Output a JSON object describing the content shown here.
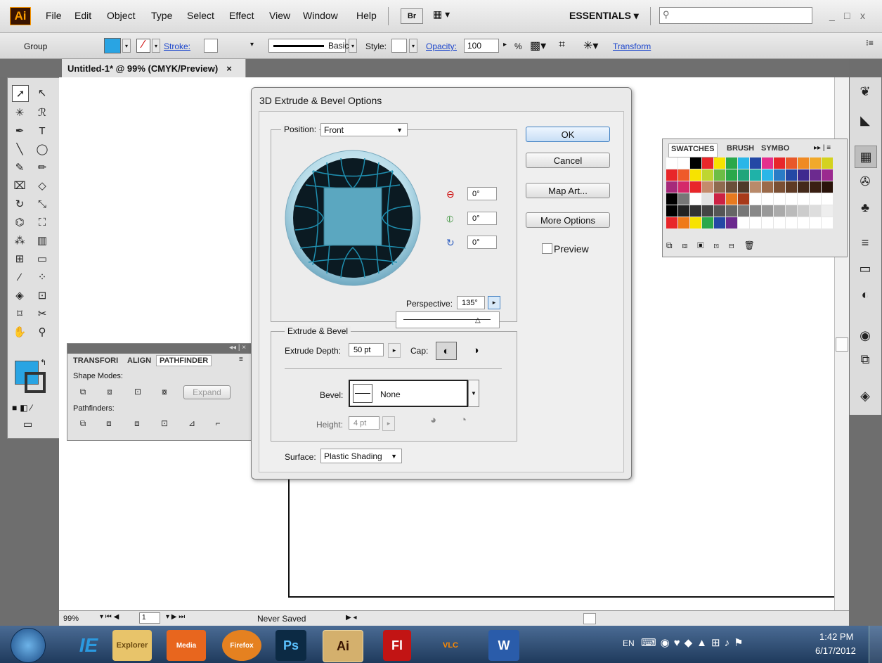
{
  "menu": {
    "logo": "Ai",
    "items": [
      "File",
      "Edit",
      "Object",
      "Type",
      "Select",
      "Effect",
      "View",
      "Window",
      "Help"
    ],
    "bridge": "Br",
    "workspace": "ESSENTIALS",
    "window_controls": [
      "_",
      "□",
      "x"
    ]
  },
  "control_bar": {
    "selection": "Group",
    "stroke_label": "Stroke:",
    "brush": "Basic",
    "style_label": "Style:",
    "opacity_label": "Opacity:",
    "opacity_value": "100",
    "percent": "%",
    "transform": "Transform"
  },
  "doc_tab": {
    "title": "Untitled-1* @ 99% (CMYK/Preview)",
    "close": "×"
  },
  "dialog": {
    "title": "3D Extrude & Bevel Options",
    "position_label": "Position:",
    "position_value": "Front",
    "rotation_x": "0°",
    "rotation_y": "0°",
    "rotation_z": "0°",
    "perspective_label": "Perspective:",
    "perspective_value": "135°",
    "buttons": {
      "ok": "OK",
      "cancel": "Cancel",
      "map_art": "Map Art...",
      "more_options": "More Options"
    },
    "preview_label": "Preview",
    "extrude_group": "Extrude & Bevel",
    "extrude_depth_label": "Extrude Depth:",
    "extrude_depth_value": "50 pt",
    "cap_label": "Cap:",
    "bevel_label": "Bevel:",
    "bevel_value": "None",
    "height_label": "Height:",
    "height_value": "4 pt",
    "surface_label": "Surface:",
    "surface_value": "Plastic Shading"
  },
  "swatches": {
    "tabs": [
      "SWATCHES",
      "BRUSH",
      "SYMBO"
    ]
  },
  "pathfinder": {
    "tabs": [
      "TRANSFORI",
      "ALIGN",
      "PATHFINDER"
    ],
    "shape_modes": "Shape Modes:",
    "expand": "Expand",
    "pathfinders": "Pathfinders:"
  },
  "status": {
    "zoom": "99%",
    "page": "1",
    "save_state": "Never Saved"
  },
  "taskbar": {
    "apps": [
      "IE",
      "Explorer",
      "Media",
      "Firefox",
      "Ps",
      "Ai",
      "Fl",
      "VLC",
      "W"
    ],
    "lang": "EN",
    "time": "1:42 PM",
    "date": "6/17/2012"
  },
  "colors": {
    "fill": "#29a4e3",
    "preview_square": "#5ba7c0",
    "accent_link": "#1a44cc"
  }
}
